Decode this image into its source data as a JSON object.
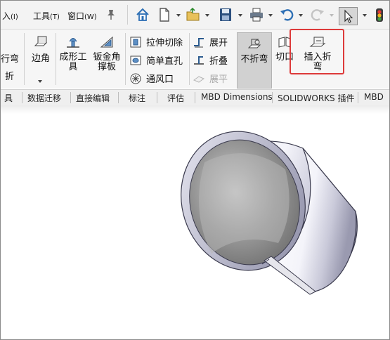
{
  "menu": {
    "items": [
      {
        "label": "入",
        "key": "(I)"
      },
      {
        "label": "工具",
        "key": "(T)"
      },
      {
        "label": "窗口",
        "key": "(W)"
      }
    ]
  },
  "quick_access": {
    "icons": [
      "home-icon",
      "new-document-icon",
      "open-folder-icon",
      "save-icon",
      "print-icon",
      "undo-icon",
      "redo-icon",
      "select-cursor-icon",
      "traffic-light-icon"
    ]
  },
  "ribbon": {
    "partial_left_1": "行弯",
    "partial_left_2": "折",
    "edge_flange": "边角",
    "forming_tool": "成形工具",
    "sheet_metal_gusset": "钣金角撑板",
    "extruded_cut": "拉伸切除",
    "simple_hole": "简单直孔",
    "vent": "通风口",
    "unfold": "展开",
    "fold": "折叠",
    "flatten": "展平",
    "no_bends": "不折弯",
    "rip": "切口",
    "insert_bends": "插入折弯"
  },
  "tabs": [
    "具",
    "数据迁移",
    "直接编辑",
    "标注",
    "评估",
    "MBD Dimensions",
    "SOLIDWORKS 插件",
    "MBD"
  ],
  "colors": {
    "highlight_box": "#dd3a3a",
    "active_button_bg": "#d1d1d1"
  }
}
